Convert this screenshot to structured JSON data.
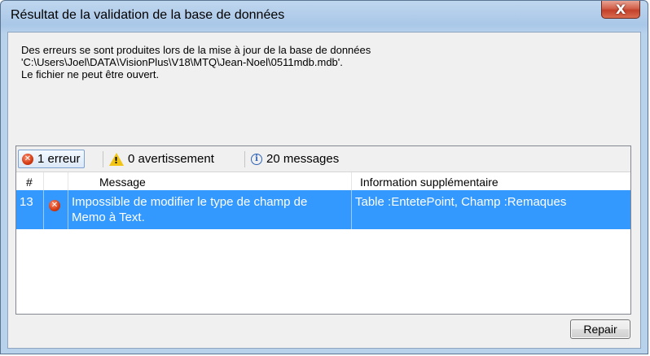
{
  "window": {
    "title": "Résultat de la validation de la base de données",
    "close_label": "X"
  },
  "message": {
    "line1": "Des erreurs se sont produites lors de la mise à jour de la base de données",
    "line2": "'C:\\Users\\Joel\\DATA\\VisionPlus\\V18\\MTQ\\Jean-Noel\\0511mdb.mdb'.",
    "line3": "Le fichier ne peut être ouvert."
  },
  "filters": {
    "errors": "1 erreur",
    "warnings": "0 avertissement",
    "messages": "20 messages"
  },
  "table": {
    "columns": [
      "#",
      "",
      "Message",
      "Information supplémentaire"
    ],
    "rows": [
      {
        "num": "13",
        "icon": "error-icon",
        "message_line1": "Impossible de modifier le type de champ de",
        "message_line2": "Memo à Text.",
        "info": "Table :EntetePoint, Champ :Remaques"
      }
    ]
  },
  "buttons": {
    "repair": "Repair"
  },
  "colors": {
    "selection": "#3399ff",
    "error": "#d23a12",
    "warning": "#f2c515",
    "info": "#2f63b5"
  }
}
